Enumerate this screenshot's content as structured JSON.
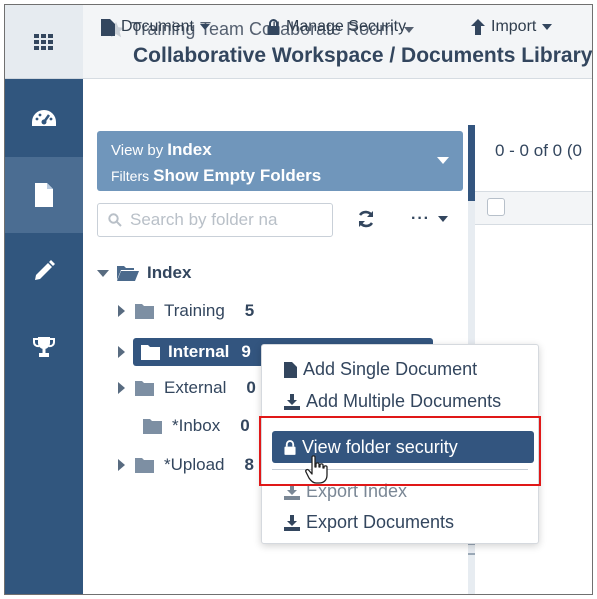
{
  "header": {
    "room": "Training Team Collaborate Room",
    "breadcrumb": "Collaborative Workspace / Documents Library"
  },
  "rail": {
    "icons": [
      "apps-grid-icon",
      "dashboard-icon",
      "document-icon",
      "pencil-icon",
      "trophy-icon"
    ]
  },
  "toolbar": {
    "document_label": "Document",
    "security_label": "Manage Security",
    "import_label": "Import"
  },
  "filter": {
    "view_by_label": "View by",
    "view_by_value": "Index",
    "filters_label": "Filters",
    "filters_value": "Show Empty Folders"
  },
  "search": {
    "placeholder": "Search by folder na"
  },
  "tree": {
    "root": "Index",
    "folders": [
      {
        "label": "Training",
        "count": "5"
      },
      {
        "label": "Internal",
        "count": "9"
      },
      {
        "label": "External",
        "count": "0"
      },
      {
        "label": "*Inbox",
        "count": "0"
      },
      {
        "label": "*Upload",
        "count": "8"
      }
    ]
  },
  "pager": {
    "text": "0 - 0 of 0 (0"
  },
  "context_menu": {
    "items": [
      "Add Single Document",
      "Add Multiple Documents",
      "View folder security",
      "Export Index",
      "Export Documents"
    ]
  },
  "colors": {
    "rail": "#31567e",
    "selected": "#33557f",
    "filter_panel": "#7096bb",
    "highlight_border": "#e01818"
  }
}
